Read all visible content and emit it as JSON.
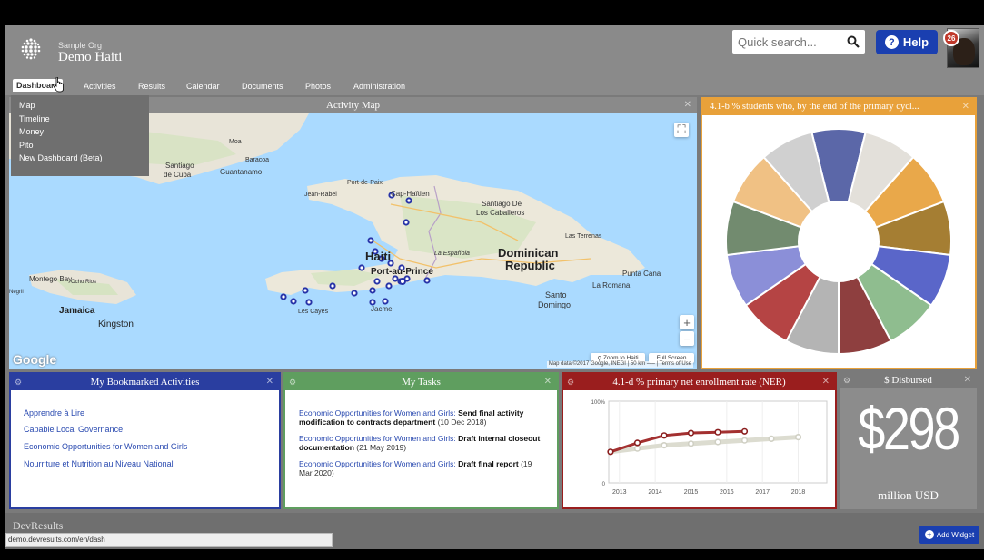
{
  "org": {
    "small_label": "Sample Org",
    "name": "Demo Haiti"
  },
  "search": {
    "placeholder": "Quick search..."
  },
  "help": {
    "label": "Help"
  },
  "user": {
    "notification_count": "26"
  },
  "nav": {
    "items": [
      "Dashboard",
      "Activities",
      "Results",
      "Calendar",
      "Documents",
      "Photos",
      "Administration"
    ],
    "active": "Dashboard",
    "dropdown": [
      "Map",
      "Timeline",
      "Money",
      "Pito",
      "New Dashboard (Beta)"
    ]
  },
  "map_panel": {
    "title": "Activity Map",
    "labels": {
      "moa": "Moa",
      "baracoa": "Baracoa",
      "santiago_cuba": "Santiago\nde Cuba",
      "guantanamo": "Guantanamo",
      "port_de_paix": "Port-de-Paix",
      "jean_rabel": "Jean-Rabel",
      "cap_haitien": "Cap-Haïtien",
      "santiago_de": "Santiago De",
      "los_caballeros": "Los Caballeros",
      "las_terrenas": "Las Terrenas",
      "haiti": "Haiti",
      "la_espanola": "La Española",
      "dominican": "Dominican",
      "republic": "Republic",
      "port_au_prince": "Port-au-Prince",
      "punta_cana": "Punta Cana",
      "la_romana": "La Romana",
      "santo": "Santo",
      "domingo": "Domingo",
      "montego_bay": "Montego Bay",
      "ocho_rios": "Ocho Rios",
      "negril": "Negril",
      "jamaica": "Jamaica",
      "kingston": "Kingston",
      "les_cayes": "Les Cayes",
      "jacmel": "Jacmel"
    },
    "google": "Google",
    "zoom_to_haiti": "Zoom to Haiti",
    "full_screen": "Full Screen",
    "attribution": "Map data ©2017 Google, INEGI | 50 km ⎯⎯⎯ | Terms of Use"
  },
  "pie_panel": {
    "title": "4.1-b % students who, by the end of the primary cycl..."
  },
  "chart_data": [
    {
      "type": "pie",
      "title": "4.1-b % students who, by the end of the primary cycl...",
      "values": [
        1,
        1,
        1,
        1,
        1,
        1,
        1,
        1,
        1,
        1,
        1,
        1,
        1
      ],
      "colors": [
        "#5b67a8",
        "#e3e0da",
        "#e9a84a",
        "#a57e33",
        "#5a66c9",
        "#8fbd8f",
        "#8e3f3f",
        "#b4b4b4",
        "#b54444",
        "#8b8fd8",
        "#728b6f",
        "#f0c184",
        "#d0d0d0"
      ]
    },
    {
      "type": "line",
      "title": "4.1-d % primary net enrollment rate (NER)",
      "x": [
        2013,
        2014,
        2015,
        2016,
        2017,
        2018
      ],
      "ylim": [
        0,
        100
      ],
      "ytick_labels": [
        "0",
        "100%"
      ],
      "series": [
        {
          "x": [
            2012.75,
            2013.5,
            2014.25,
            2015.0,
            2015.75,
            2016.5
          ],
          "values": [
            38,
            49,
            58,
            61,
            62,
            63
          ],
          "color": "#a33030"
        },
        {
          "x": [
            2012.75,
            2013.5,
            2014.25,
            2015.0,
            2015.75,
            2016.5,
            2017.25,
            2018.0
          ],
          "values": [
            38,
            42,
            46,
            48,
            50,
            52,
            54,
            56
          ],
          "color": "#dcdcd0"
        }
      ]
    }
  ],
  "ner_panel": {
    "title": "4.1-d % primary net enrollment rate (NER)"
  },
  "bookmarks": {
    "title": "My Bookmarked Activities",
    "items": [
      "Apprendre à Lire",
      "Capable Local Governance",
      "Economic Opportunities for Women and Girls",
      "Nourriture et Nutrition au Niveau National"
    ]
  },
  "tasks": {
    "title": "My Tasks",
    "items": [
      {
        "activity": "Economic Opportunities for Women and Girls:",
        "task": "Send final activity modification to contracts department",
        "date": "(10 Dec 2018)"
      },
      {
        "activity": "Economic Opportunities for Women and Girls:",
        "task": "Draft internal closeout documentation",
        "date": "(21 May 2019)"
      },
      {
        "activity": "Economic Opportunities for Women and Girls:",
        "task": "Draft final report",
        "date": "(19 Mar 2020)"
      }
    ]
  },
  "disbursed": {
    "title": "$ Disbursed",
    "amount": "$298",
    "unit": "million USD"
  },
  "footer": {
    "logo": "DevResults",
    "status_url": "demo.devresults.com/en/dash",
    "add_widget": "Add Widget"
  },
  "colors": {
    "primary_blue": "#1a3fb0",
    "bookmark_blue": "#2a3ea0",
    "tasks_green": "#5f9e5f",
    "ner_red": "#9a1e1e",
    "pie_orange": "#e8a13a"
  },
  "icons": [
    "globe-logo-icon",
    "search-icon",
    "help-icon",
    "fullscreen-icon",
    "map-pin-icon",
    "plus-icon"
  ]
}
